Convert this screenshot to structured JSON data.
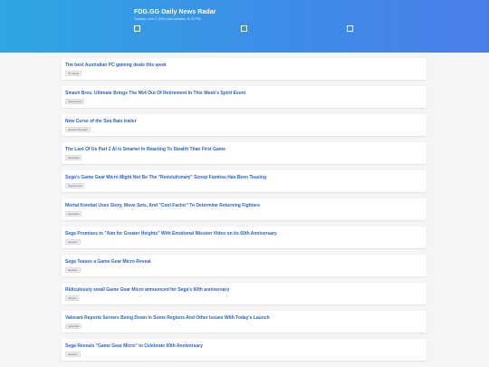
{
  "header": {
    "title": "FDG.GG Daily News Radar",
    "updated": "Tuesday, June 2, 2020 (Last Updated: 11:42 PM)",
    "filters": [
      {
        "name": "filter-checkbox-1"
      },
      {
        "name": "filter-checkbox-2"
      },
      {
        "name": "filter-checkbox-3"
      }
    ]
  },
  "articles": [
    {
      "title": "The best Australian PC gaming deals this week",
      "source": "PC Gamer"
    },
    {
      "title": "Smash Bros. Ultimate Brings The N64 Out Of Retirement In This Week's Spirit Event",
      "source": "Nintendo Life"
    },
    {
      "title": "New Curse of the Sea Rats trailer",
      "source": "Gematsu Roundup"
    },
    {
      "title": "The Last Of Us Part 2 AI Is Smarter In Reacting To Stealth Than First Game",
      "source": "GameSpot"
    },
    {
      "title": "Sega's Game Gear Micro Might Not Be The \"Revolutionary\" Scoop Famitsu Has Been Teasing",
      "source": "Nintendo Life"
    },
    {
      "title": "Mortal Kombat Uses Story, Move Sets, And \"Cool Factor\" To Determine Returning Fighters",
      "source": "GameSpot"
    },
    {
      "title": "Sega Promises to \"Aim for Greater Heights\" With Emotional Mission Video on its 60th Anniversary",
      "source": "Gematsu"
    },
    {
      "title": "Sega Teases a Game Gear Micro Reveal",
      "source": "Gematsu"
    },
    {
      "title": "Ridiculously small Game Gear Micro announced for Sega's 60th anniversary",
      "source": "Polygon"
    },
    {
      "title": "Valorant Reports Servers Being Down In Some Regions And Other Issues With Today's Launch",
      "source": "GameSpot"
    },
    {
      "title": "Sega Reveals \"Game Gear Micro\" to Celebrate 60th Anniversary",
      "source": "Gematsu"
    }
  ]
}
